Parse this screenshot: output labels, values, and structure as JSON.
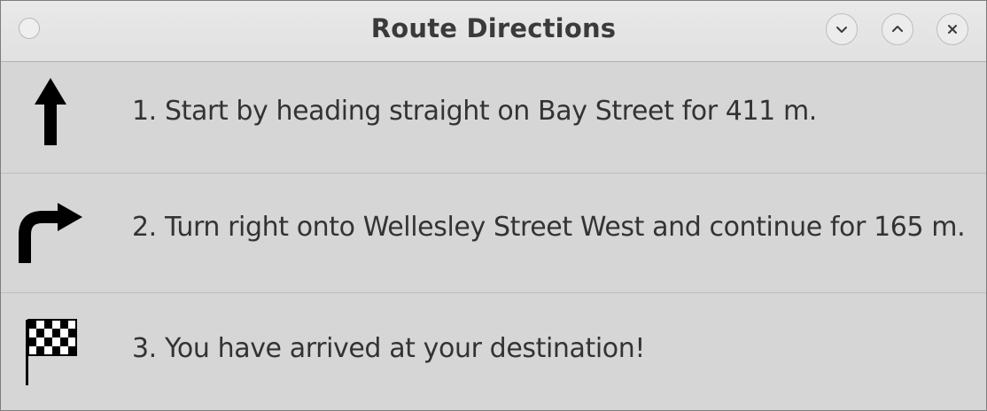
{
  "window": {
    "title": "Route Directions"
  },
  "controls": {
    "minimize_icon": "chevron-down-icon",
    "maximize_icon": "chevron-up-icon",
    "close_icon": "close-icon"
  },
  "directions": [
    {
      "text": "1. Start by heading straight on Bay Street for 411 m.",
      "icon": "arrow-up-icon"
    },
    {
      "text": "2. Turn right onto Wellesley Street West and continue for 165 m.",
      "icon": "turn-right-icon"
    },
    {
      "text": "3. You have arrived at your destination!",
      "icon": "checkered-flag-icon"
    }
  ],
  "colors": {
    "background": "#d6d6d6",
    "titlebar": "#e4e4e4",
    "text": "#333333"
  }
}
